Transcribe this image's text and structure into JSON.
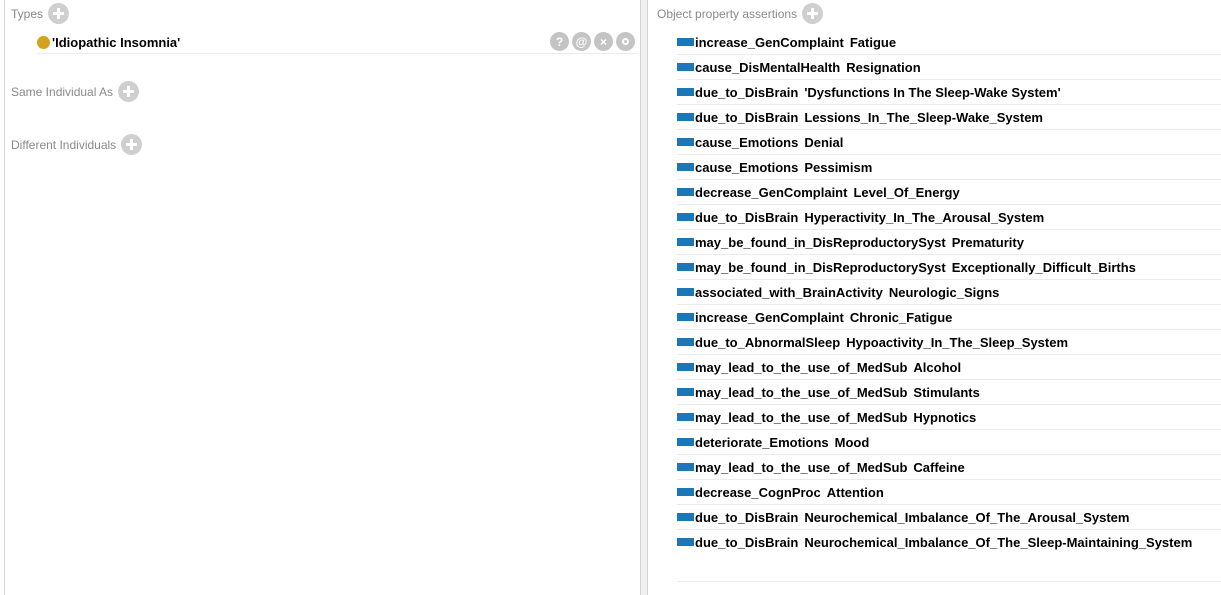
{
  "types": {
    "header": "Types",
    "items": [
      {
        "label": "'Idiopathic Insomnia'",
        "actions": [
          "?",
          "@",
          "×",
          "o"
        ]
      }
    ]
  },
  "same_individual_as": {
    "header": "Same Individual As"
  },
  "different_individuals": {
    "header": "Different Individuals"
  },
  "object_property_assertions": {
    "header": "Object property assertions",
    "items": [
      {
        "property": "increase_GenComplaint",
        "value": "Fatigue"
      },
      {
        "property": "cause_DisMentalHealth",
        "value": "Resignation"
      },
      {
        "property": "due_to_DisBrain",
        "value": "'Dysfunctions In The Sleep-Wake System'"
      },
      {
        "property": "due_to_DisBrain",
        "value": "Lessions_In_The_Sleep-Wake_System"
      },
      {
        "property": "cause_Emotions",
        "value": "Denial"
      },
      {
        "property": "cause_Emotions",
        "value": "Pessimism"
      },
      {
        "property": "decrease_GenComplaint",
        "value": "Level_Of_Energy"
      },
      {
        "property": "due_to_DisBrain",
        "value": "Hyperactivity_In_The_Arousal_System"
      },
      {
        "property": "may_be_found_in_DisReproductorySyst",
        "value": "Prematurity"
      },
      {
        "property": "may_be_found_in_DisReproductorySyst",
        "value": "Exceptionally_Difficult_Births"
      },
      {
        "property": "associated_with_BrainActivity",
        "value": "Neurologic_Signs"
      },
      {
        "property": "increase_GenComplaint",
        "value": "Chronic_Fatigue"
      },
      {
        "property": "due_to_AbnormalSleep",
        "value": "Hypoactivity_In_The_Sleep_System"
      },
      {
        "property": "may_lead_to_the_use_of_MedSub",
        "value": "Alcohol"
      },
      {
        "property": "may_lead_to_the_use_of_MedSub",
        "value": "Stimulants"
      },
      {
        "property": "may_lead_to_the_use_of_MedSub",
        "value": "Hypnotics"
      },
      {
        "property": "deteriorate_Emotions",
        "value": "Mood"
      },
      {
        "property": "may_lead_to_the_use_of_MedSub",
        "value": "Caffeine"
      },
      {
        "property": "decrease_CognProc",
        "value": "Attention"
      },
      {
        "property": "due_to_DisBrain",
        "value": "Neurochemical_Imbalance_Of_The_Arousal_System"
      },
      {
        "property": "due_to_DisBrain",
        "value": "Neurochemical_Imbalance_Of_The_Sleep-Maintaining_System"
      }
    ]
  },
  "colors": {
    "individual_icon": "#d4a21c",
    "object_property_icon": "#1b77b8",
    "header_text": "#8a8a8a"
  },
  "icons": {
    "individual": "individual-icon",
    "object_property": "object-property-icon",
    "add": "add-icon"
  }
}
